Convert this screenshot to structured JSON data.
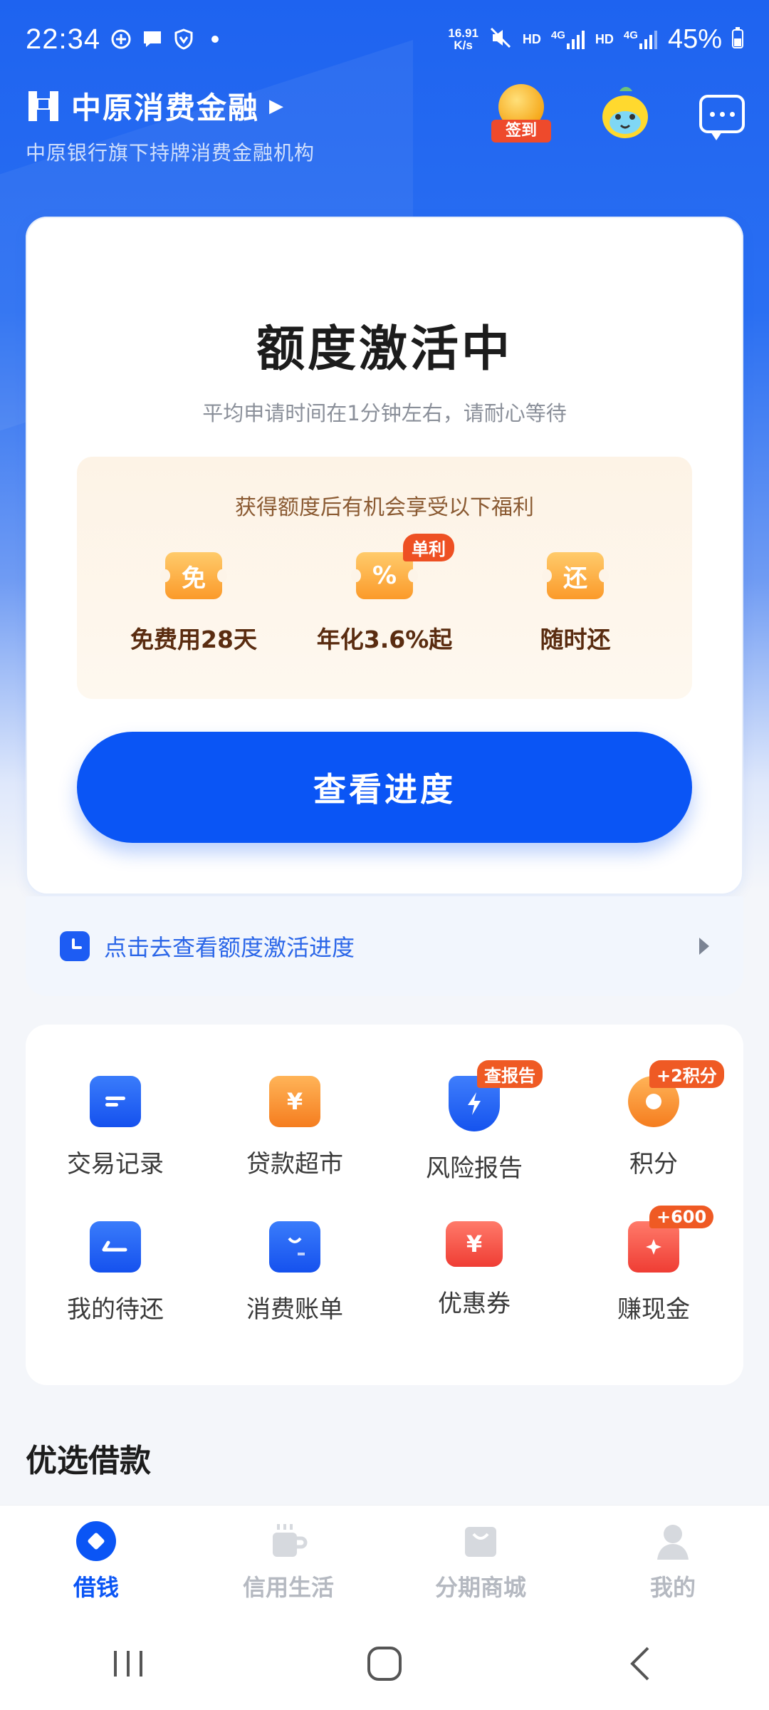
{
  "status_bar": {
    "time": "22:34",
    "net_speed_value": "16.91",
    "net_speed_unit": "K/s",
    "hd1": "HD",
    "hd2": "HD",
    "sig1": "4G",
    "sig2": "4G",
    "battery": "45%",
    "icons": [
      "plus-circle-icon",
      "chat-bubble-icon",
      "shield-v-icon",
      "dot-icon",
      "mute-icon",
      "signal-icon",
      "battery-charging-icon"
    ]
  },
  "header": {
    "brand_name": "中原消费金融",
    "brand_sub": "中原银行旗下持牌消费金融机构",
    "signin_label": "签到",
    "icons": [
      "brand-logo-icon",
      "signin-coin-icon",
      "mascot-icon",
      "message-icon"
    ]
  },
  "activation": {
    "title": "额度激活中",
    "subtitle": "平均申请时间在1分钟左右，请耐心等待",
    "benefits_heading": "获得额度后有机会享受以下福利",
    "benefits": [
      {
        "icon_text": "免",
        "label": "免费用28天",
        "tag": ""
      },
      {
        "icon_text": "%",
        "label": "年化3.6%起",
        "tag": "单利"
      },
      {
        "icon_text": "还",
        "label": "随时还",
        "tag": ""
      }
    ],
    "button_label": "查看进度",
    "progress_link": "点击去查看额度激活进度"
  },
  "services": [
    {
      "label": "交易记录",
      "tag": ""
    },
    {
      "label": "贷款超市",
      "tag": "",
      "icon_text": "¥"
    },
    {
      "label": "风险报告",
      "tag": "查报告"
    },
    {
      "label": "积分",
      "tag": "+2积分"
    },
    {
      "label": "我的待还",
      "tag": ""
    },
    {
      "label": "消费账单",
      "tag": ""
    },
    {
      "label": "优惠券",
      "tag": "",
      "icon_text": "¥"
    },
    {
      "label": "赚现金",
      "tag": "+600"
    }
  ],
  "section_title": "优选借款",
  "tabs": [
    {
      "label": "借钱"
    },
    {
      "label": "信用生活"
    },
    {
      "label": "分期商城"
    },
    {
      "label": "我的"
    }
  ],
  "colors": {
    "primary": "#0a55f5",
    "benefit_text": "#5a2c10",
    "tag_red": "#ef5a24"
  }
}
